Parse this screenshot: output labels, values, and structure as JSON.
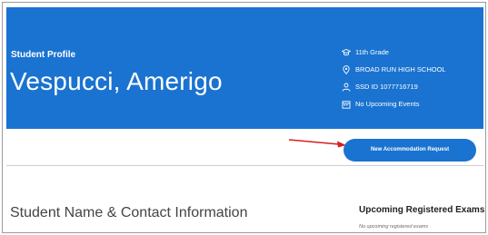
{
  "profile": {
    "eyebrow": "Student Profile",
    "name": "Vespucci, Amerigo",
    "banner_color": "#1a73d0",
    "meta": [
      {
        "icon": "graduation-cap-icon",
        "text": "11th Grade"
      },
      {
        "icon": "location-pin-icon",
        "text": "BROAD RUN HIGH SCHOOL"
      },
      {
        "icon": "person-icon",
        "text": "SSD ID 1077716719"
      },
      {
        "icon": "calendar-icon",
        "text": "No Upcoming Events"
      }
    ]
  },
  "actions": {
    "new_request_label": "New Accommodation Request",
    "arrow_color": "#d61f1f"
  },
  "main": {
    "contact_title": "Student Name & Contact Information"
  },
  "exams": {
    "title": "Upcoming Registered Exams",
    "empty_text": "No upcoming registered exams"
  }
}
